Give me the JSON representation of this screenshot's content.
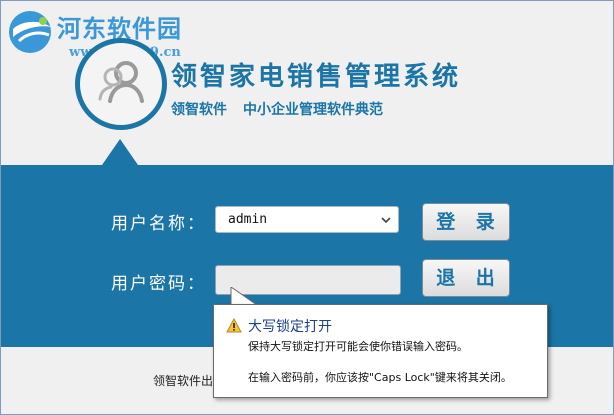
{
  "watermark": {
    "name": "河东软件园",
    "url": "www.pc0359.cn"
  },
  "app": {
    "title": "领智家电销售管理系统",
    "subtitle_1": "领智软件",
    "subtitle_2": "中小企业管理软件典范"
  },
  "login": {
    "username_label": "用户名称：",
    "username_value": "admin",
    "password_label": "用户密码：",
    "password_value": "",
    "login_button": "登 录",
    "exit_button": "退 出"
  },
  "footer": {
    "text": "领智软件出"
  },
  "tooltip": {
    "title": "大写锁定打开",
    "line1": "保持大写锁定打开可能会使你错误输入密码。",
    "line2": "在输入密码前，你应该按\"Caps Lock\"键来将其关闭。"
  },
  "colors": {
    "brand_blue": "#1b75a6",
    "header_bg": "#f0f0f0",
    "watermark_blue": "#3a98d8"
  },
  "icons": [
    "watermark-logo-icon",
    "users-icon",
    "dropdown-arrow-icon",
    "warning-icon"
  ]
}
